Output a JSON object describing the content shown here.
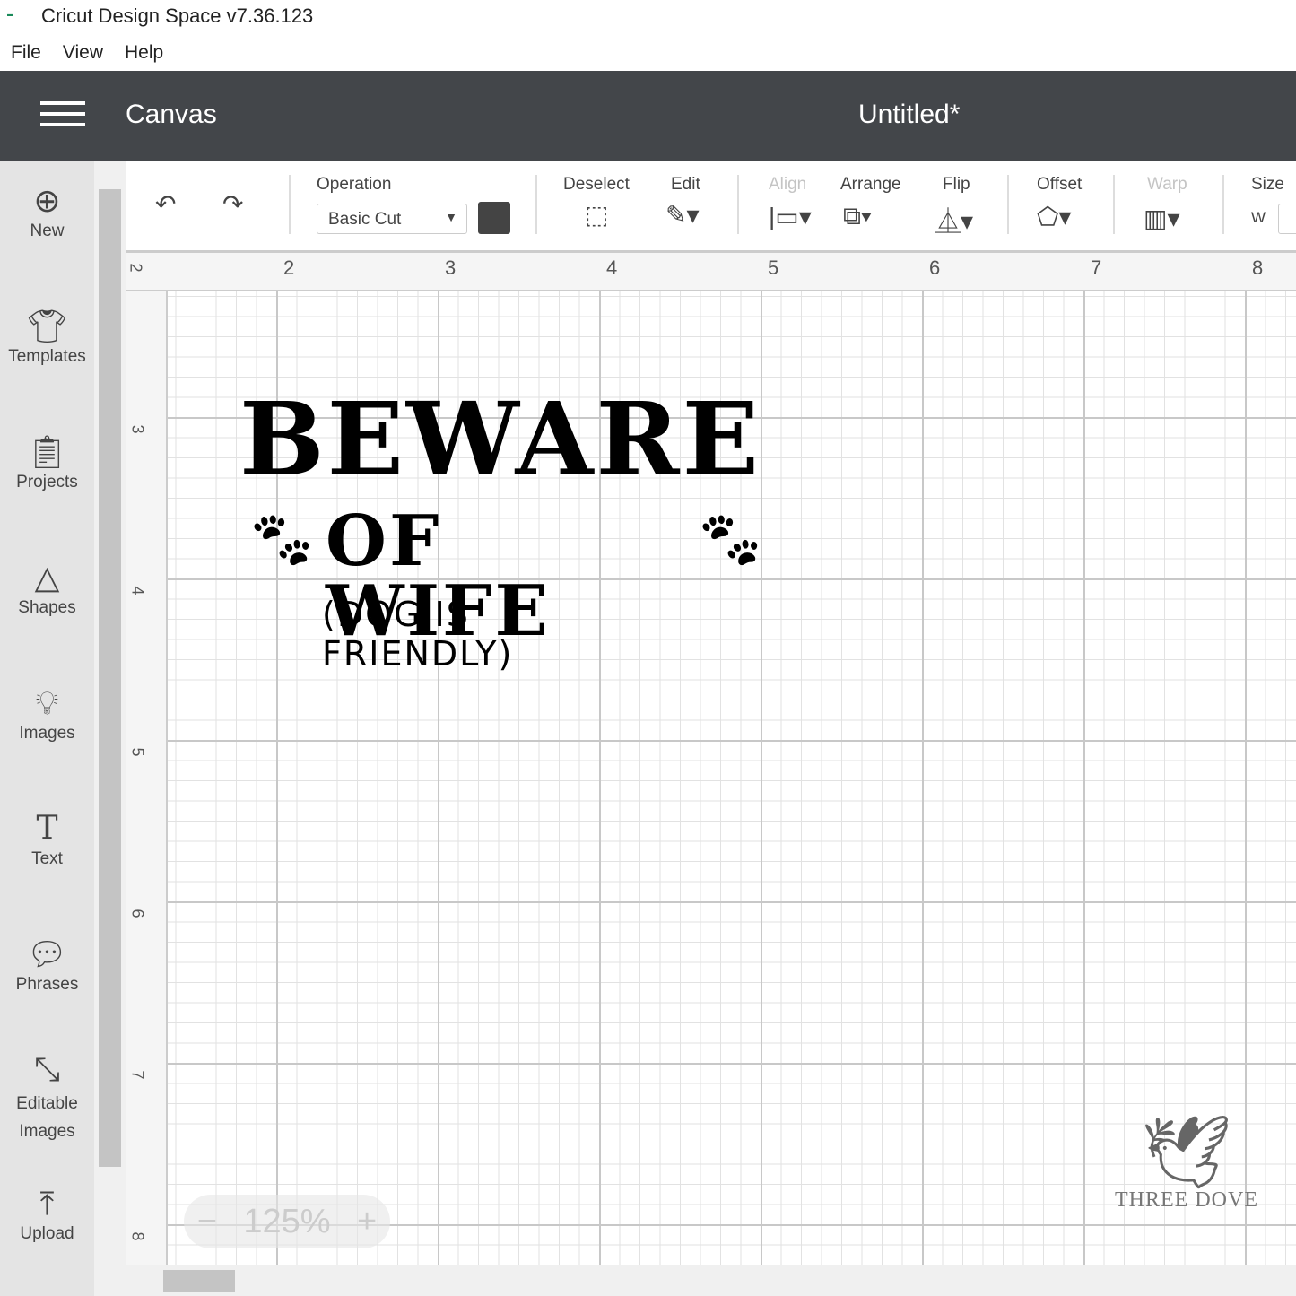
{
  "window": {
    "title": "Cricut Design Space  v7.36.123",
    "logo_text": "cricut"
  },
  "menu": [
    "File",
    "View",
    "Help"
  ],
  "header": {
    "section": "Canvas",
    "document": "Untitled*"
  },
  "sidebar": [
    {
      "label": "New",
      "icon": "plus-circle-icon"
    },
    {
      "label": "Templates",
      "icon": "shirt-icon"
    },
    {
      "label": "Projects",
      "icon": "clipboard-icon"
    },
    {
      "label": "Shapes",
      "icon": "shapes-icon"
    },
    {
      "label": "Images",
      "icon": "lightbulb-icon"
    },
    {
      "label": "Text",
      "icon": "text-icon"
    },
    {
      "label": "Phrases",
      "icon": "speech-bubble-icon"
    },
    {
      "label": "Editable Images",
      "icon": "editable-image-icon"
    },
    {
      "label": "Upload",
      "icon": "upload-icon"
    }
  ],
  "toolbar": {
    "operation_label": "Operation",
    "operation_value": "Basic Cut",
    "color": "#444444",
    "deselect": "Deselect",
    "edit": "Edit",
    "align": "Align",
    "arrange": "Arrange",
    "flip": "Flip",
    "offset": "Offset",
    "warp": "Warp",
    "size": "Size",
    "w_label": "W"
  },
  "ruler": {
    "top": [
      "2",
      "2",
      "3",
      "4",
      "5",
      "6",
      "7",
      "8"
    ],
    "left": [
      "3",
      "4",
      "5",
      "6",
      "7",
      "8"
    ]
  },
  "design": {
    "line1": "BEWARE",
    "line2": "OF WIFE",
    "line3": "(DOG IS FRIENDLY)",
    "color": "#000000"
  },
  "zoom": {
    "value": "125%",
    "minus": "−",
    "plus": "+"
  },
  "watermark": "THREE DOVE"
}
